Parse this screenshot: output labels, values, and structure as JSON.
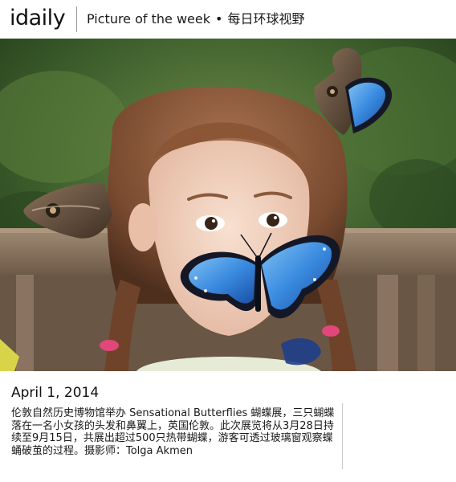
{
  "header": {
    "logo": "idaily",
    "title_en": "Picture of the week",
    "separator": "•",
    "title_cn": "每日环球视野"
  },
  "photo": {
    "subject": "girl-with-butterflies",
    "colors": {
      "background_foliage": "#3b5e2b",
      "bench": "#8a7460",
      "hair": "#8b5a3a",
      "skin": "#f1d2c0",
      "butterfly_blue": "#2f7fd6",
      "butterfly_dark": "#141826",
      "owl_butterfly": "#6b5440"
    }
  },
  "caption": {
    "date": "April 1, 2014",
    "body": "伦敦自然历史博物馆举办 Sensational Butterflies 蝴蝶展，三只蝴蝶落在一名小女孩的头发和鼻翼上，英国伦敦。此次展览将从3月28日持续至9月15日，共展出超过500只热带蝴蝶，游客可透过玻璃窗观察蝶蛹破茧的过程。摄影师：Tolga Akmen"
  }
}
